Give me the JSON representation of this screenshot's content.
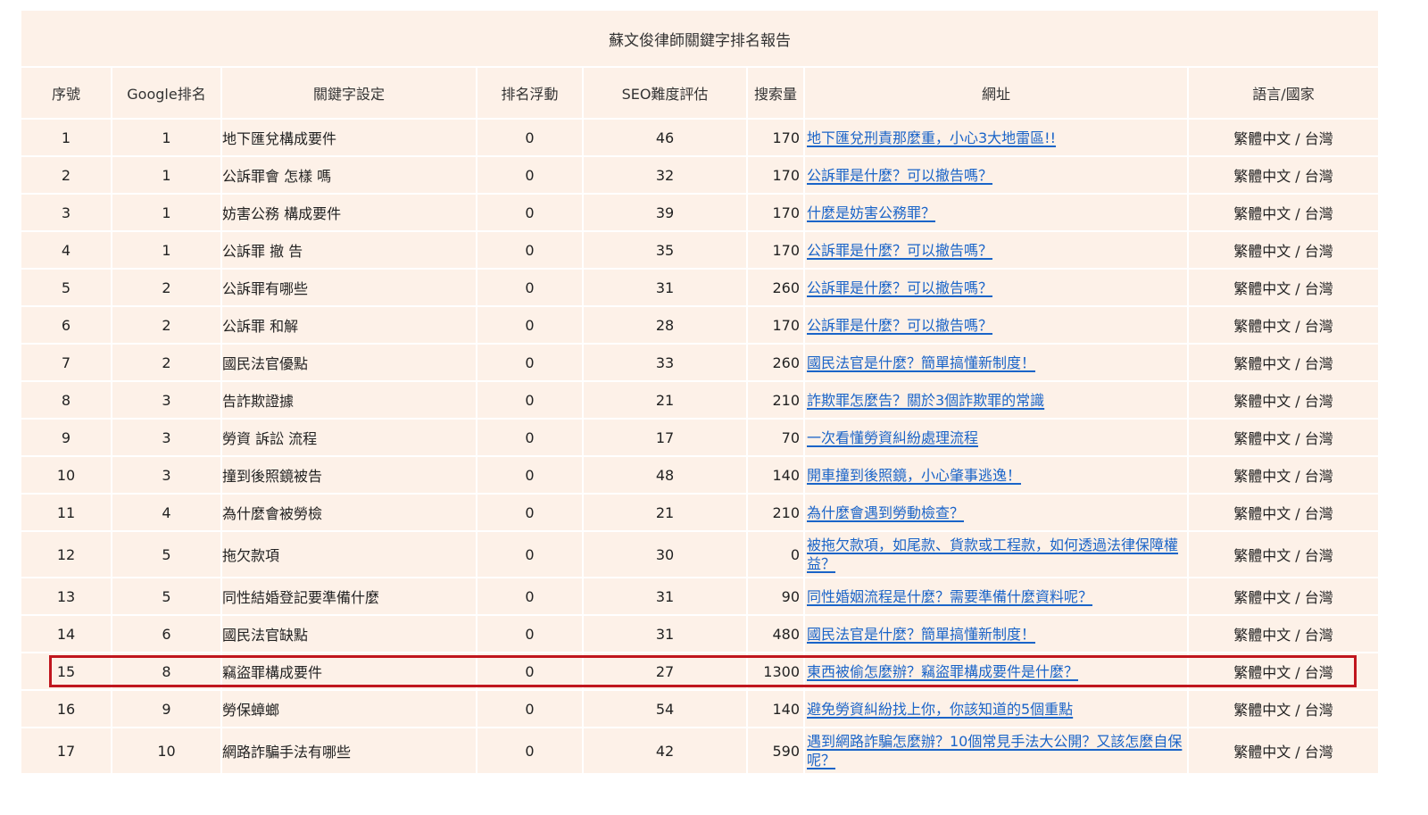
{
  "report": {
    "title": "蘇文俊律師關鍵字排名報告",
    "columns": [
      "序號",
      "Google排名",
      "關鍵字設定",
      "排名浮動",
      "SEO難度評估",
      "搜索量",
      "網址",
      "語言/國家"
    ],
    "rows": [
      {
        "idx": "1",
        "rank": "1",
        "keyword": "地下匯兌構成要件",
        "float": "0",
        "seo": "46",
        "volume": "170",
        "url_text": "地下匯兌刑責那麼重，小心3大地雷區!!",
        "lang": "繁體中文 / 台灣"
      },
      {
        "idx": "2",
        "rank": "1",
        "keyword": "公訴罪會 怎樣 嗎",
        "float": "0",
        "seo": "32",
        "volume": "170",
        "url_text": "公訴罪是什麼？可以撤告嗎？",
        "lang": "繁體中文 / 台灣"
      },
      {
        "idx": "3",
        "rank": "1",
        "keyword": "妨害公務 構成要件",
        "float": "0",
        "seo": "39",
        "volume": "170",
        "url_text": "什麼是妨害公務罪？",
        "lang": "繁體中文 / 台灣"
      },
      {
        "idx": "4",
        "rank": "1",
        "keyword": "公訴罪 撤 告",
        "float": "0",
        "seo": "35",
        "volume": "170",
        "url_text": "公訴罪是什麼？可以撤告嗎？",
        "lang": "繁體中文 / 台灣"
      },
      {
        "idx": "5",
        "rank": "2",
        "keyword": "公訴罪有哪些",
        "float": "0",
        "seo": "31",
        "volume": "260",
        "url_text": "公訴罪是什麼？可以撤告嗎？",
        "lang": "繁體中文 / 台灣"
      },
      {
        "idx": "6",
        "rank": "2",
        "keyword": "公訴罪 和解",
        "float": "0",
        "seo": "28",
        "volume": "170",
        "url_text": "公訴罪是什麼？可以撤告嗎？",
        "lang": "繁體中文 / 台灣"
      },
      {
        "idx": "7",
        "rank": "2",
        "keyword": "國民法官優點",
        "float": "0",
        "seo": "33",
        "volume": "260",
        "url_text": "國民法官是什麼？簡單搞懂新制度！",
        "lang": "繁體中文 / 台灣"
      },
      {
        "idx": "8",
        "rank": "3",
        "keyword": "告詐欺證據",
        "float": "0",
        "seo": "21",
        "volume": "210",
        "url_text": "詐欺罪怎麼告？關於3個詐欺罪的常識",
        "lang": "繁體中文 / 台灣"
      },
      {
        "idx": "9",
        "rank": "3",
        "keyword": "勞資 訴訟 流程",
        "float": "0",
        "seo": "17",
        "volume": "70",
        "url_text": "一次看懂勞資糾紛處理流程",
        "lang": "繁體中文 / 台灣"
      },
      {
        "idx": "10",
        "rank": "3",
        "keyword": "撞到後照鏡被告",
        "float": "0",
        "seo": "48",
        "volume": "140",
        "url_text": "開車撞到後照鏡，小心肇事逃逸！",
        "lang": "繁體中文 / 台灣"
      },
      {
        "idx": "11",
        "rank": "4",
        "keyword": "為什麼會被勞檢",
        "float": "0",
        "seo": "21",
        "volume": "210",
        "url_text": "為什麼會遇到勞動檢查？",
        "lang": "繁體中文 / 台灣"
      },
      {
        "idx": "12",
        "rank": "5",
        "keyword": "拖欠款項",
        "float": "0",
        "seo": "30",
        "volume": "0",
        "url_text": "被拖欠款項，如尾款、貨款或工程款，如何透過法律保障權益？",
        "lang": "繁體中文 / 台灣"
      },
      {
        "idx": "13",
        "rank": "5",
        "keyword": "同性結婚登記要準備什麼",
        "float": "0",
        "seo": "31",
        "volume": "90",
        "url_text": "同性婚姻流程是什麼？需要準備什麼資料呢？",
        "lang": "繁體中文 / 台灣"
      },
      {
        "idx": "14",
        "rank": "6",
        "keyword": "國民法官缺點",
        "float": "0",
        "seo": "31",
        "volume": "480",
        "url_text": "國民法官是什麼？簡單搞懂新制度！",
        "lang": "繁體中文 / 台灣"
      },
      {
        "idx": "15",
        "rank": "8",
        "keyword": "竊盜罪構成要件",
        "float": "0",
        "seo": "27",
        "volume": "1300",
        "url_text": "東西被偷怎麼辦？竊盜罪構成要件是什麼？",
        "lang": "繁體中文 / 台灣"
      },
      {
        "idx": "16",
        "rank": "9",
        "keyword": "勞保蟑螂",
        "float": "0",
        "seo": "54",
        "volume": "140",
        "url_text": "避免勞資糾紛找上你，你該知道的5個重點",
        "lang": "繁體中文 / 台灣"
      },
      {
        "idx": "17",
        "rank": "10",
        "keyword": "網路詐騙手法有哪些",
        "float": "0",
        "seo": "42",
        "volume": "590",
        "url_text": "遇到網路詐騙怎麼辦？10個常見手法大公開？又該怎麼自保呢？",
        "lang": "繁體中文 / 台灣"
      }
    ],
    "highlighted_row": "15",
    "colors": {
      "background": "#fdf1e8",
      "link": "#1a64c8",
      "highlight": "#c0161e"
    }
  }
}
